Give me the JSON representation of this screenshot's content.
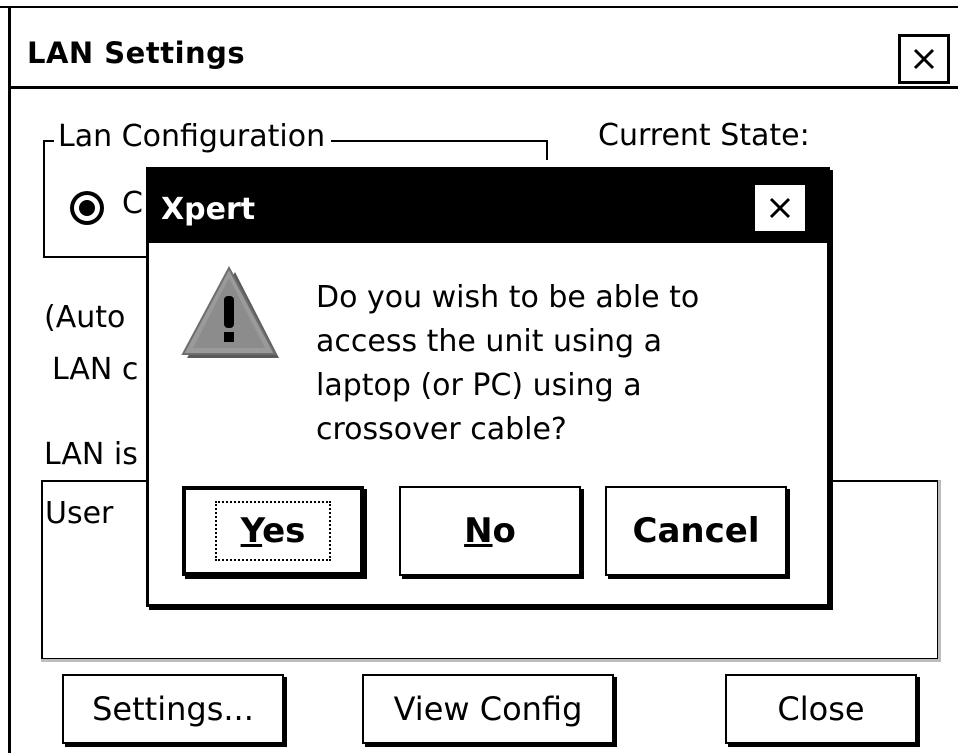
{
  "window": {
    "title": "LAN Settings",
    "close_glyph": "✕"
  },
  "lan_config": {
    "group_label": "Lan Configuration",
    "radio_partial_label": "C",
    "current_state_label": "Current State:"
  },
  "info": {
    "auto_partial": "(Auto",
    "lan_partial": "LAN c",
    "lan_is_partial": "LAN is"
  },
  "listbox": {
    "first_column_partial": "User"
  },
  "buttons": {
    "settings": "Settings...",
    "view_config": "View Config",
    "close": "Close"
  },
  "dialog": {
    "title": "Xpert",
    "icon": "warning-icon",
    "message": "Do you wish to be able to\naccess the unit using a\nlaptop (or PC) using a\ncrossover cable?",
    "yes_mnemonic": "Y",
    "yes_rest": "es",
    "no_mnemonic": "N",
    "no_rest": "o",
    "cancel": "Cancel"
  }
}
